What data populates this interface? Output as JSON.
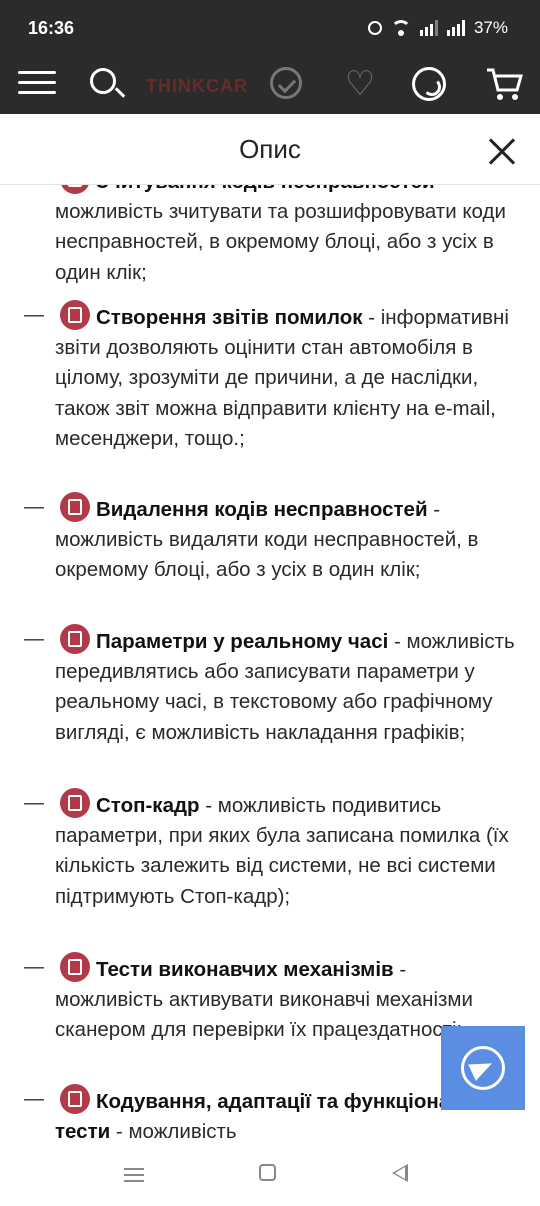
{
  "status": {
    "time": "16:36",
    "battery": "37%"
  },
  "appbar": {
    "logo": "THINKCAR"
  },
  "modal": {
    "title": "Опис"
  },
  "items": [
    {
      "head": "Зчитування кодів несправностей",
      "text": "можливість зчитувати та розшифровувати коди несправностей, в окремому блоці, або з усіх в один клік;"
    },
    {
      "head": "Створення звітів помилок",
      "text": "інформативні звіти дозволяють оцінити стан автомобіля в цілому, зрозуміти де причини, а де наслідки, також звіт можна відправити клієнту на e-mail, месенджери, тощо.;"
    },
    {
      "head": "Видалення кодів несправностей",
      "text": "можливість видаляти коди несправностей, в окремому блоці, або з усіх в один клік;"
    },
    {
      "head": "Параметри у реальному часі",
      "text": "можливість передивлятись або записувати параметри у реальному часі, в текстовому або графічному вигляді, є можливість накладання графіків;"
    },
    {
      "head": "Стоп-кадр",
      "text": "можливість подивитись параметри, при яких була записана помилка (їх кількість залежить від системи, не всі системи підтримують Стоп-кадр);"
    },
    {
      "head": "Тести виконавчих механізмів",
      "text": "можливість активувати виконавчі механізми сканером для перевірки їх працездатності;"
    },
    {
      "head": "Кодування, адаптації та функціональні тести",
      "text": "можливість"
    }
  ],
  "separator": " - ",
  "dash": "—"
}
